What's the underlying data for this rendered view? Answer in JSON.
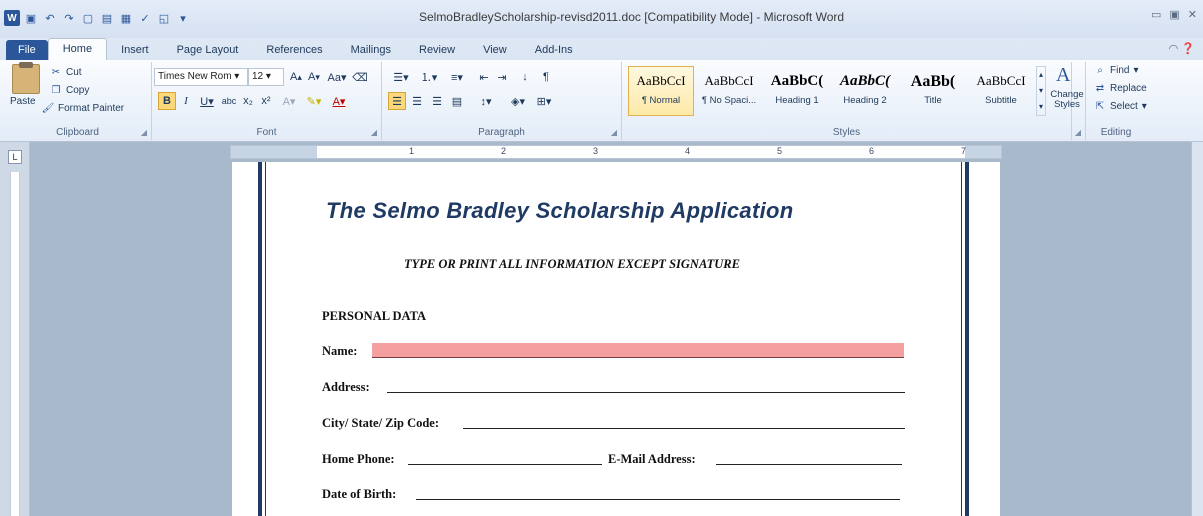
{
  "window": {
    "title": "SelmoBradleyScholarship-revisd2011.doc [Compatibility Mode] - Microsoft Word",
    "quick_access": [
      "word-icon",
      "save-icon",
      "undo-icon",
      "redo-icon",
      "new-icon",
      "open-icon",
      "print-icon",
      "spelling-icon",
      "print-preview-icon"
    ],
    "controls": [
      "minimize",
      "restore",
      "close"
    ]
  },
  "tabs": [
    "File",
    "Home",
    "Insert",
    "Page Layout",
    "References",
    "Mailings",
    "Review",
    "View",
    "Add-Ins"
  ],
  "active_tab": "Home",
  "ribbon": {
    "clipboard": {
      "label": "Clipboard",
      "paste": "Paste",
      "cut": "Cut",
      "copy": "Copy",
      "format_painter": "Format Painter"
    },
    "font": {
      "label": "Font",
      "font_name": "Times New Rom",
      "font_size": "12"
    },
    "paragraph": {
      "label": "Paragraph"
    },
    "styles": {
      "label": "Styles",
      "items": [
        {
          "sample": "AaBbCcI",
          "name": "¶ Normal"
        },
        {
          "sample": "AaBbCcI",
          "name": "¶ No Spaci..."
        },
        {
          "sample": "AaBbC(",
          "name": "Heading 1"
        },
        {
          "sample": "AaBbC(",
          "name": "Heading 2"
        },
        {
          "sample": "AaBb(",
          "name": "Title"
        },
        {
          "sample": "AaBbCcI",
          "name": "Subtitle"
        }
      ],
      "change_styles": "Change Styles"
    },
    "editing": {
      "label": "Editing",
      "find": "Find",
      "replace": "Replace",
      "select": "Select"
    }
  },
  "ruler": {
    "numbers": [
      "1",
      "2",
      "3",
      "4",
      "5",
      "6",
      "7"
    ]
  },
  "document": {
    "title": "The Selmo Bradley Scholarship Application",
    "subtitle": "TYPE OR PRINT ALL INFORMATION EXCEPT SIGNATURE",
    "section": "PERSONAL DATA",
    "fields": {
      "name": "Name:",
      "address": "Address:",
      "city_state_zip": "City/ State/ Zip Code:",
      "home_phone": "Home Phone:",
      "email": "E-Mail Address:",
      "dob": "Date of Birth:"
    }
  },
  "colors": {
    "accent": "#2b579a",
    "border": "#1f3a63",
    "highlight": "#f4a0a0"
  }
}
